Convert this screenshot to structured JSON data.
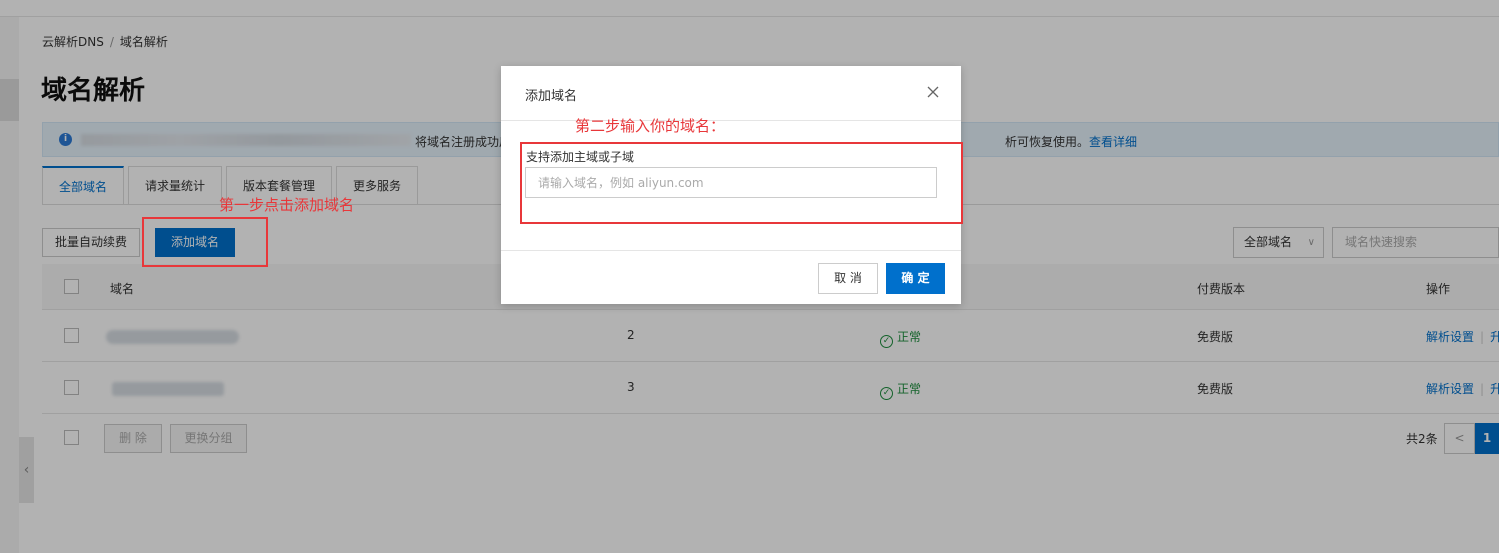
{
  "breadcrumb": {
    "root": "云解析DNS",
    "separator": "/",
    "current": "域名解析"
  },
  "page_title": "域名解析",
  "notice": {
    "icon": "info-icon",
    "prefix_text": "d.",
    "middle_text": "将域名注册成功后,",
    "suffix_text": "析可恢复使用。",
    "link_text": "查看详细"
  },
  "tabs": [
    {
      "label": "全部域名",
      "active": true
    },
    {
      "label": "请求量统计",
      "active": false
    },
    {
      "label": "版本套餐管理",
      "active": false
    },
    {
      "label": "更多服务",
      "active": false
    }
  ],
  "toolbar": {
    "batch_renew_label": "批量自动续费",
    "add_domain_label": "添加域名",
    "filter_value": "全部域名",
    "search_placeholder": "域名快速搜索"
  },
  "table": {
    "columns": {
      "domain": "域名",
      "version": "付费版本",
      "actions": "操作"
    },
    "rows": [
      {
        "records": "2",
        "status": "正常",
        "version": "免费版",
        "action": "解析设置",
        "action_more": "升"
      },
      {
        "records": "3",
        "status": "正常",
        "version": "免费版",
        "action": "解析设置",
        "action_more": "升"
      }
    ]
  },
  "footer": {
    "delete_label": "删 除",
    "change_group_label": "更换分组",
    "total_text": "共2条",
    "prev_symbol": "<",
    "current_page": "1"
  },
  "modal": {
    "title": "添加域名",
    "close_symbol": "X",
    "field_label": "支持添加主域或子域",
    "input_placeholder": "请输入域名，例如 aliyun.com",
    "cancel_label": "取 消",
    "confirm_label": "确 定"
  },
  "annotations": {
    "step1": "第一步点击添加域名",
    "step2": "第二步输入你的域名："
  },
  "colors": {
    "primary": "#0070cc",
    "success": "#1e8e3e",
    "annotation": "#e8373a"
  }
}
